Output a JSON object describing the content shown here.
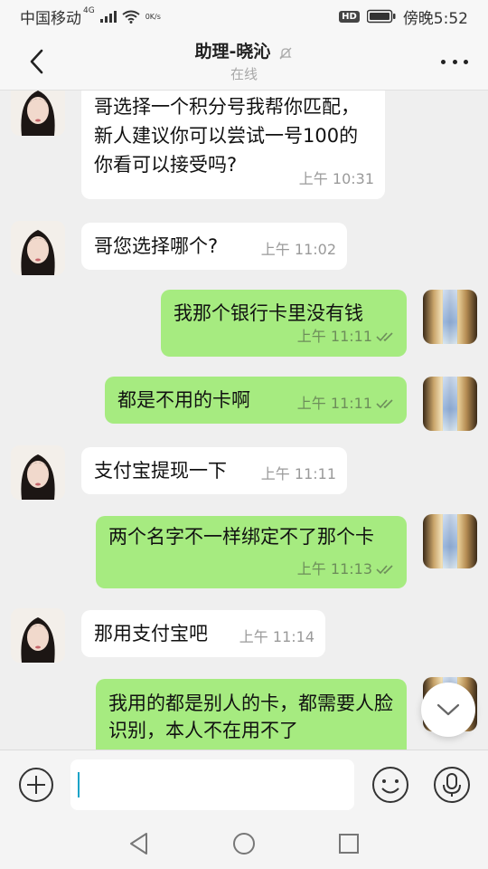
{
  "status_bar": {
    "carrier": "中国移动",
    "network": "4G",
    "speed": "0K/s",
    "hd": "HD",
    "time": "傍晚5:52"
  },
  "header": {
    "title": "助理-晓沁",
    "subtitle": "在线"
  },
  "messages": [
    {
      "side": "in",
      "text": "哥选择一个积分号我帮你匹配，新人建议你可以尝试一号100的你看可以接受吗?",
      "time": "上午 10:31"
    },
    {
      "side": "in",
      "text": "哥您选择哪个?",
      "time": "上午 11:02"
    },
    {
      "side": "out",
      "text": "我那个银行卡里没有钱",
      "time": "上午 11:11"
    },
    {
      "side": "out",
      "text": "都是不用的卡啊",
      "time": "上午 11:11"
    },
    {
      "side": "in",
      "text": "支付宝提现一下",
      "time": "上午 11:11"
    },
    {
      "side": "out",
      "text": "两个名字不一样绑定不了那个卡",
      "time": "上午 11:13"
    },
    {
      "side": "in",
      "text": "那用支付宝吧",
      "time": "上午 11:14"
    },
    {
      "side": "out",
      "text": "我用的都是别人的卡，都需要人脸识别，本人不在用不了",
      "time": ""
    }
  ],
  "input": {
    "value": "",
    "icons": [
      "plus-icon",
      "emoji-icon",
      "microphone-icon"
    ]
  },
  "nav": [
    "back-triangle-icon",
    "home-circle-icon",
    "recents-square-icon"
  ],
  "colors": {
    "outgoing_bubble": "#a6eb80",
    "incoming_bubble": "#ffffff",
    "background": "#efefef"
  }
}
